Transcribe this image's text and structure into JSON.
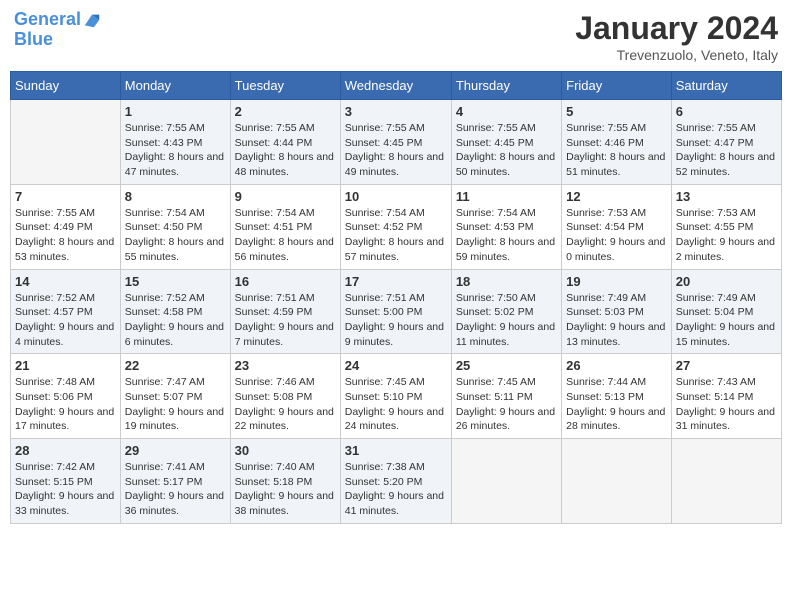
{
  "header": {
    "logo_line1": "General",
    "logo_line2": "Blue",
    "month_title": "January 2024",
    "subtitle": "Trevenzuolo, Veneto, Italy"
  },
  "weekdays": [
    "Sunday",
    "Monday",
    "Tuesday",
    "Wednesday",
    "Thursday",
    "Friday",
    "Saturday"
  ],
  "weeks": [
    [
      {
        "day": "",
        "sunrise": "",
        "sunset": "",
        "daylight": ""
      },
      {
        "day": "1",
        "sunrise": "Sunrise: 7:55 AM",
        "sunset": "Sunset: 4:43 PM",
        "daylight": "Daylight: 8 hours and 47 minutes."
      },
      {
        "day": "2",
        "sunrise": "Sunrise: 7:55 AM",
        "sunset": "Sunset: 4:44 PM",
        "daylight": "Daylight: 8 hours and 48 minutes."
      },
      {
        "day": "3",
        "sunrise": "Sunrise: 7:55 AM",
        "sunset": "Sunset: 4:45 PM",
        "daylight": "Daylight: 8 hours and 49 minutes."
      },
      {
        "day": "4",
        "sunrise": "Sunrise: 7:55 AM",
        "sunset": "Sunset: 4:45 PM",
        "daylight": "Daylight: 8 hours and 50 minutes."
      },
      {
        "day": "5",
        "sunrise": "Sunrise: 7:55 AM",
        "sunset": "Sunset: 4:46 PM",
        "daylight": "Daylight: 8 hours and 51 minutes."
      },
      {
        "day": "6",
        "sunrise": "Sunrise: 7:55 AM",
        "sunset": "Sunset: 4:47 PM",
        "daylight": "Daylight: 8 hours and 52 minutes."
      }
    ],
    [
      {
        "day": "7",
        "sunrise": "Sunrise: 7:55 AM",
        "sunset": "Sunset: 4:49 PM",
        "daylight": "Daylight: 8 hours and 53 minutes."
      },
      {
        "day": "8",
        "sunrise": "Sunrise: 7:54 AM",
        "sunset": "Sunset: 4:50 PM",
        "daylight": "Daylight: 8 hours and 55 minutes."
      },
      {
        "day": "9",
        "sunrise": "Sunrise: 7:54 AM",
        "sunset": "Sunset: 4:51 PM",
        "daylight": "Daylight: 8 hours and 56 minutes."
      },
      {
        "day": "10",
        "sunrise": "Sunrise: 7:54 AM",
        "sunset": "Sunset: 4:52 PM",
        "daylight": "Daylight: 8 hours and 57 minutes."
      },
      {
        "day": "11",
        "sunrise": "Sunrise: 7:54 AM",
        "sunset": "Sunset: 4:53 PM",
        "daylight": "Daylight: 8 hours and 59 minutes."
      },
      {
        "day": "12",
        "sunrise": "Sunrise: 7:53 AM",
        "sunset": "Sunset: 4:54 PM",
        "daylight": "Daylight: 9 hours and 0 minutes."
      },
      {
        "day": "13",
        "sunrise": "Sunrise: 7:53 AM",
        "sunset": "Sunset: 4:55 PM",
        "daylight": "Daylight: 9 hours and 2 minutes."
      }
    ],
    [
      {
        "day": "14",
        "sunrise": "Sunrise: 7:52 AM",
        "sunset": "Sunset: 4:57 PM",
        "daylight": "Daylight: 9 hours and 4 minutes."
      },
      {
        "day": "15",
        "sunrise": "Sunrise: 7:52 AM",
        "sunset": "Sunset: 4:58 PM",
        "daylight": "Daylight: 9 hours and 6 minutes."
      },
      {
        "day": "16",
        "sunrise": "Sunrise: 7:51 AM",
        "sunset": "Sunset: 4:59 PM",
        "daylight": "Daylight: 9 hours and 7 minutes."
      },
      {
        "day": "17",
        "sunrise": "Sunrise: 7:51 AM",
        "sunset": "Sunset: 5:00 PM",
        "daylight": "Daylight: 9 hours and 9 minutes."
      },
      {
        "day": "18",
        "sunrise": "Sunrise: 7:50 AM",
        "sunset": "Sunset: 5:02 PM",
        "daylight": "Daylight: 9 hours and 11 minutes."
      },
      {
        "day": "19",
        "sunrise": "Sunrise: 7:49 AM",
        "sunset": "Sunset: 5:03 PM",
        "daylight": "Daylight: 9 hours and 13 minutes."
      },
      {
        "day": "20",
        "sunrise": "Sunrise: 7:49 AM",
        "sunset": "Sunset: 5:04 PM",
        "daylight": "Daylight: 9 hours and 15 minutes."
      }
    ],
    [
      {
        "day": "21",
        "sunrise": "Sunrise: 7:48 AM",
        "sunset": "Sunset: 5:06 PM",
        "daylight": "Daylight: 9 hours and 17 minutes."
      },
      {
        "day": "22",
        "sunrise": "Sunrise: 7:47 AM",
        "sunset": "Sunset: 5:07 PM",
        "daylight": "Daylight: 9 hours and 19 minutes."
      },
      {
        "day": "23",
        "sunrise": "Sunrise: 7:46 AM",
        "sunset": "Sunset: 5:08 PM",
        "daylight": "Daylight: 9 hours and 22 minutes."
      },
      {
        "day": "24",
        "sunrise": "Sunrise: 7:45 AM",
        "sunset": "Sunset: 5:10 PM",
        "daylight": "Daylight: 9 hours and 24 minutes."
      },
      {
        "day": "25",
        "sunrise": "Sunrise: 7:45 AM",
        "sunset": "Sunset: 5:11 PM",
        "daylight": "Daylight: 9 hours and 26 minutes."
      },
      {
        "day": "26",
        "sunrise": "Sunrise: 7:44 AM",
        "sunset": "Sunset: 5:13 PM",
        "daylight": "Daylight: 9 hours and 28 minutes."
      },
      {
        "day": "27",
        "sunrise": "Sunrise: 7:43 AM",
        "sunset": "Sunset: 5:14 PM",
        "daylight": "Daylight: 9 hours and 31 minutes."
      }
    ],
    [
      {
        "day": "28",
        "sunrise": "Sunrise: 7:42 AM",
        "sunset": "Sunset: 5:15 PM",
        "daylight": "Daylight: 9 hours and 33 minutes."
      },
      {
        "day": "29",
        "sunrise": "Sunrise: 7:41 AM",
        "sunset": "Sunset: 5:17 PM",
        "daylight": "Daylight: 9 hours and 36 minutes."
      },
      {
        "day": "30",
        "sunrise": "Sunrise: 7:40 AM",
        "sunset": "Sunset: 5:18 PM",
        "daylight": "Daylight: 9 hours and 38 minutes."
      },
      {
        "day": "31",
        "sunrise": "Sunrise: 7:38 AM",
        "sunset": "Sunset: 5:20 PM",
        "daylight": "Daylight: 9 hours and 41 minutes."
      },
      {
        "day": "",
        "sunrise": "",
        "sunset": "",
        "daylight": ""
      },
      {
        "day": "",
        "sunrise": "",
        "sunset": "",
        "daylight": ""
      },
      {
        "day": "",
        "sunrise": "",
        "sunset": "",
        "daylight": ""
      }
    ]
  ]
}
